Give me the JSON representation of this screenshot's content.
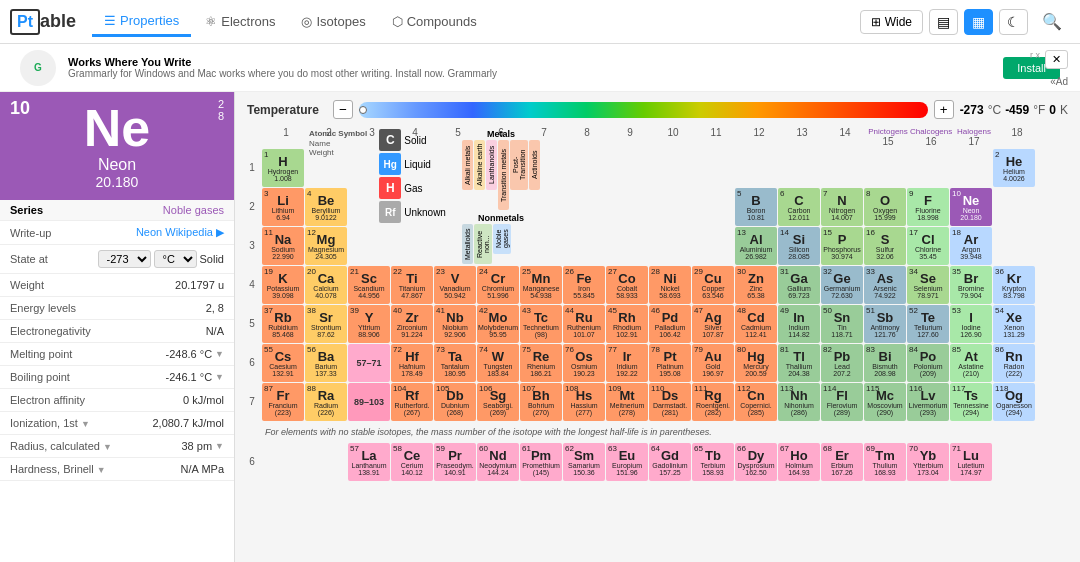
{
  "header": {
    "logo": "Pt",
    "logo_text": "able",
    "nav": [
      {
        "id": "properties",
        "label": "Properties",
        "icon": "☰",
        "active": true
      },
      {
        "id": "electrons",
        "label": "Electrons",
        "icon": "⚛",
        "active": false
      },
      {
        "id": "isotopes",
        "label": "Isotopes",
        "icon": "◎",
        "active": false
      },
      {
        "id": "compounds",
        "label": "Compounds",
        "icon": "⬡",
        "active": false
      }
    ],
    "wide_label": "Wide",
    "search_icon": "🔍"
  },
  "ad": {
    "logo": "G",
    "title": "Works Where You Write",
    "description": "Grammarly for Windows and Mac works where you do most other writing. Install now. Grammarly",
    "install_label": "Install",
    "close": "r x",
    "ad_label": "«Ad"
  },
  "left_panel": {
    "atomic_number": "10",
    "electrons": "2\n8",
    "symbol": "Ne",
    "name": "Neon",
    "weight": "20.180",
    "series_label": "Series",
    "series_value": "Noble gases",
    "writeup_label": "Write-up",
    "writeup_value": "Neon",
    "writeup_link": "Wikipedia",
    "state_label": "State at",
    "state_temp": "-273",
    "state_unit": "°C",
    "state_value": "Solid",
    "weight_label": "Weight",
    "weight_value": "20.1797 u",
    "energy_label": "Energy levels",
    "energy_value": "2, 8",
    "electronegativity_label": "Electronegativity",
    "electronegativity_value": "N/A",
    "melting_label": "Melting point",
    "melting_value": "-248.6 °C",
    "boiling_label": "Boiling point",
    "boiling_value": "-246.1 °C",
    "electron_affinity_label": "Electron affinity",
    "electron_affinity_value": "0 kJ/mol",
    "ionization_label": "Ionization, 1st",
    "ionization_value": "2,080.7 kJ/mol",
    "radius_label": "Radius, calculated",
    "radius_value": "38 pm",
    "hardness_label": "Hardness, Brinell",
    "hardness_value": "N/A MPa"
  },
  "temp_bar": {
    "label": "Temperature",
    "celsius": "-273",
    "fahrenheit": "-459",
    "kelvin": "0",
    "unit_c": "°C",
    "unit_f": "°F",
    "unit_k": "K"
  },
  "legend": {
    "atomic_symbol_label": "Atomic Symbol",
    "name_label": "Name",
    "weight_label": "Weight",
    "solid_label": "Solid",
    "liquid_label": "Liquid",
    "gas_label": "Gas",
    "unknown_label": "Unknown"
  },
  "group_labels": [
    "1",
    "2",
    "3",
    "4",
    "5",
    "6",
    "7",
    "8",
    "9",
    "10",
    "11",
    "12",
    "13",
    "14",
    "15",
    "16",
    "17",
    "18"
  ],
  "period_labels": [
    "1",
    "2",
    "3",
    "4",
    "5",
    "6",
    "7"
  ],
  "special_groups": {
    "pnictogens": "Pnictogens",
    "chalcogens": "Chalcogens",
    "halogens": "Halogens"
  },
  "footnote": "For elements with no stable isotopes, the mass number of the isotope with the longest half-life is in parentheses.",
  "elements": {
    "row1": [
      {
        "n": 1,
        "sym": "H",
        "name": "Hydrogen",
        "wt": "1.008",
        "cat": "reactive-nonmetal"
      },
      {
        "n": 2,
        "sym": "He",
        "name": "Helium",
        "wt": "4.0026",
        "cat": "noble"
      }
    ],
    "row2": [
      {
        "n": 3,
        "sym": "Li",
        "name": "Lithium",
        "wt": "6.94",
        "cat": "alkali"
      },
      {
        "n": 4,
        "sym": "Be",
        "name": "Beryllium",
        "wt": "9.0122",
        "cat": "alkaline"
      },
      {
        "n": 5,
        "sym": "B",
        "name": "Boron",
        "wt": "10.81",
        "cat": "metalloid"
      },
      {
        "n": 6,
        "sym": "C",
        "name": "Carbon",
        "wt": "12.011",
        "cat": "reactive-nonmetal"
      },
      {
        "n": 7,
        "sym": "N",
        "name": "Nitrogen",
        "wt": "14.007",
        "cat": "reactive-nonmetal"
      },
      {
        "n": 8,
        "sym": "O",
        "name": "Oxygen",
        "wt": "15.999",
        "cat": "reactive-nonmetal"
      },
      {
        "n": 9,
        "sym": "F",
        "name": "Fluorine",
        "wt": "18.998",
        "cat": "halogen"
      },
      {
        "n": 10,
        "sym": "Ne",
        "name": "Neon",
        "wt": "20.180",
        "cat": "noble"
      }
    ],
    "row3": [
      {
        "n": 11,
        "sym": "Na",
        "name": "Sodium",
        "wt": "22.990",
        "cat": "alkali"
      },
      {
        "n": 12,
        "sym": "Mg",
        "name": "Magnesium",
        "wt": "24.305",
        "cat": "alkaline"
      },
      {
        "n": 13,
        "sym": "Al",
        "name": "Aluminium",
        "wt": "26.982",
        "cat": "post-trans"
      },
      {
        "n": 14,
        "sym": "Si",
        "name": "Silicon",
        "wt": "28.085",
        "cat": "metalloid"
      },
      {
        "n": 15,
        "sym": "P",
        "name": "Phosphorus",
        "wt": "30.974",
        "cat": "reactive-nonmetal"
      },
      {
        "n": 16,
        "sym": "S",
        "name": "Sulfur",
        "wt": "32.06",
        "cat": "reactive-nonmetal"
      },
      {
        "n": 17,
        "sym": "Cl",
        "name": "Chlorine",
        "wt": "35.45",
        "cat": "halogen"
      },
      {
        "n": 18,
        "sym": "Ar",
        "name": "Argon",
        "wt": "39.948",
        "cat": "noble"
      }
    ],
    "row4": [
      {
        "n": 19,
        "sym": "K",
        "name": "Potassium",
        "wt": "39.098",
        "cat": "alkali"
      },
      {
        "n": 20,
        "sym": "Ca",
        "name": "Calcium",
        "wt": "40.078",
        "cat": "alkaline"
      },
      {
        "n": 21,
        "sym": "Sc",
        "name": "Scandium",
        "wt": "44.956",
        "cat": "transition-metal"
      },
      {
        "n": 22,
        "sym": "Ti",
        "name": "Titanium",
        "wt": "47.867",
        "cat": "transition-metal"
      },
      {
        "n": 23,
        "sym": "V",
        "name": "Vanadium",
        "wt": "50.942",
        "cat": "transition-metal"
      },
      {
        "n": 24,
        "sym": "Cr",
        "name": "Chromium",
        "wt": "51.996",
        "cat": "transition-metal"
      },
      {
        "n": 25,
        "sym": "Mn",
        "name": "Manganese",
        "wt": "54.938",
        "cat": "transition-metal"
      },
      {
        "n": 26,
        "sym": "Fe",
        "name": "Iron",
        "wt": "55.845",
        "cat": "transition-metal"
      },
      {
        "n": 27,
        "sym": "Co",
        "name": "Cobalt",
        "wt": "58.933",
        "cat": "transition-metal"
      },
      {
        "n": 28,
        "sym": "Ni",
        "name": "Nickel",
        "wt": "58.693",
        "cat": "transition-metal"
      },
      {
        "n": 29,
        "sym": "Cu",
        "name": "Copper",
        "wt": "63.546",
        "cat": "transition-metal"
      },
      {
        "n": 30,
        "sym": "Zn",
        "name": "Zinc",
        "wt": "65.38",
        "cat": "transition-metal"
      },
      {
        "n": 31,
        "sym": "Ga",
        "name": "Gallium",
        "wt": "69.723",
        "cat": "post-trans"
      },
      {
        "n": 32,
        "sym": "Ge",
        "name": "Germanium",
        "wt": "72.630",
        "cat": "metalloid"
      },
      {
        "n": 33,
        "sym": "As",
        "name": "Arsenic",
        "wt": "74.922",
        "cat": "metalloid"
      },
      {
        "n": 34,
        "sym": "Se",
        "name": "Selenium",
        "wt": "78.971",
        "cat": "reactive-nonmetal"
      },
      {
        "n": 35,
        "sym": "Br",
        "name": "Bromine",
        "wt": "79.904",
        "cat": "halogen"
      },
      {
        "n": 36,
        "sym": "Kr",
        "name": "Krypton",
        "wt": "83.798",
        "cat": "noble"
      }
    ],
    "row5": [
      {
        "n": 37,
        "sym": "Rb",
        "name": "Rubidium",
        "wt": "85.468",
        "cat": "alkali"
      },
      {
        "n": 38,
        "sym": "Sr",
        "name": "Strontium",
        "wt": "87.62",
        "cat": "alkaline"
      },
      {
        "n": 39,
        "sym": "Y",
        "name": "Yttrium",
        "wt": "88.906",
        "cat": "transition-metal"
      },
      {
        "n": 40,
        "sym": "Zr",
        "name": "Zirconium",
        "wt": "91.224",
        "cat": "transition-metal"
      },
      {
        "n": 41,
        "sym": "Nb",
        "name": "Niobium",
        "wt": "92.906",
        "cat": "transition-metal"
      },
      {
        "n": 42,
        "sym": "Mo",
        "name": "Molybdenum",
        "wt": "95.95",
        "cat": "transition-metal"
      },
      {
        "n": 43,
        "sym": "Tc",
        "name": "Technetium",
        "wt": "(98)",
        "cat": "transition-metal"
      },
      {
        "n": 44,
        "sym": "Ru",
        "name": "Ruthenium",
        "wt": "101.07",
        "cat": "transition-metal"
      },
      {
        "n": 45,
        "sym": "Rh",
        "name": "Rhodium",
        "wt": "102.91",
        "cat": "transition-metal"
      },
      {
        "n": 46,
        "sym": "Pd",
        "name": "Palladium",
        "wt": "106.42",
        "cat": "transition-metal"
      },
      {
        "n": 47,
        "sym": "Ag",
        "name": "Silver",
        "wt": "107.87",
        "cat": "transition-metal"
      },
      {
        "n": 48,
        "sym": "Cd",
        "name": "Cadmium",
        "wt": "112.41",
        "cat": "transition-metal"
      },
      {
        "n": 49,
        "sym": "In",
        "name": "Indium",
        "wt": "114.82",
        "cat": "post-trans"
      },
      {
        "n": 50,
        "sym": "Sn",
        "name": "Tin",
        "wt": "118.71",
        "cat": "post-trans"
      },
      {
        "n": 51,
        "sym": "Sb",
        "name": "Antimony",
        "wt": "121.76",
        "cat": "metalloid"
      },
      {
        "n": 52,
        "sym": "Te",
        "name": "Tellurium",
        "wt": "127.60",
        "cat": "metalloid"
      },
      {
        "n": 53,
        "sym": "I",
        "name": "Iodine",
        "wt": "126.90",
        "cat": "halogen"
      },
      {
        "n": 54,
        "sym": "Xe",
        "name": "Xenon",
        "wt": "131.29",
        "cat": "noble"
      }
    ],
    "row6": [
      {
        "n": 55,
        "sym": "Cs",
        "name": "Caesium",
        "wt": "132.91",
        "cat": "alkali"
      },
      {
        "n": 56,
        "sym": "Ba",
        "name": "Barium",
        "wt": "137.33",
        "cat": "alkaline"
      },
      {
        "n": 57,
        "sym": "La",
        "name": "57-71",
        "wt": "",
        "cat": "lanthanide-ref"
      },
      {
        "n": 72,
        "sym": "Hf",
        "name": "Hafnium",
        "wt": "178.49",
        "cat": "transition-metal"
      },
      {
        "n": 73,
        "sym": "Ta",
        "name": "Tantalum",
        "wt": "180.95",
        "cat": "transition-metal"
      },
      {
        "n": 74,
        "sym": "W",
        "name": "Tungsten",
        "wt": "183.84",
        "cat": "transition-metal"
      },
      {
        "n": 75,
        "sym": "Re",
        "name": "Rhenium",
        "wt": "186.21",
        "cat": "transition-metal"
      },
      {
        "n": 76,
        "sym": "Os",
        "name": "Osmium",
        "wt": "190.23",
        "cat": "transition-metal"
      },
      {
        "n": 77,
        "sym": "Ir",
        "name": "Iridium",
        "wt": "192.22",
        "cat": "transition-metal"
      },
      {
        "n": 78,
        "sym": "Pt",
        "name": "Platinum",
        "wt": "195.08",
        "cat": "transition-metal"
      },
      {
        "n": 79,
        "sym": "Au",
        "name": "Gold",
        "wt": "196.97",
        "cat": "transition-metal"
      },
      {
        "n": 80,
        "sym": "Hg",
        "name": "Mercury",
        "wt": "200.59",
        "cat": "transition-metal"
      },
      {
        "n": 81,
        "sym": "Tl",
        "name": "Thallium",
        "wt": "204.38",
        "cat": "post-trans"
      },
      {
        "n": 82,
        "sym": "Pb",
        "name": "Lead",
        "wt": "207.2",
        "cat": "post-trans"
      },
      {
        "n": 83,
        "sym": "Bi",
        "name": "Bismuth",
        "wt": "208.98",
        "cat": "post-trans"
      },
      {
        "n": 84,
        "sym": "Po",
        "name": "Polonium",
        "wt": "(209)",
        "cat": "post-trans"
      },
      {
        "n": 85,
        "sym": "At",
        "name": "Astatine",
        "wt": "(210)",
        "cat": "halogen"
      },
      {
        "n": 86,
        "sym": "Rn",
        "name": "Radon",
        "wt": "(222)",
        "cat": "noble"
      }
    ],
    "row7": [
      {
        "n": 87,
        "sym": "Fr",
        "name": "Francium",
        "wt": "(223)",
        "cat": "alkali"
      },
      {
        "n": 88,
        "sym": "Ra",
        "name": "Radium",
        "wt": "(226)",
        "cat": "alkaline"
      },
      {
        "n": 89,
        "sym": "Ac",
        "name": "89-103",
        "wt": "",
        "cat": "actinide-ref"
      },
      {
        "n": 104,
        "sym": "Rf",
        "name": "Rutherford.",
        "wt": "(267)",
        "cat": "transition-metal"
      },
      {
        "n": 105,
        "sym": "Db",
        "name": "Dubnium",
        "wt": "(268)",
        "cat": "transition-metal"
      },
      {
        "n": 106,
        "sym": "Sg",
        "name": "Seaborgi.",
        "wt": "(269)",
        "cat": "transition-metal"
      },
      {
        "n": 107,
        "sym": "Bh",
        "name": "Bohrium",
        "wt": "(270)",
        "cat": "transition-metal"
      },
      {
        "n": 108,
        "sym": "Hs",
        "name": "Hassium",
        "wt": "(277)",
        "cat": "transition-metal"
      },
      {
        "n": 109,
        "sym": "Mt",
        "name": "Meitnerium",
        "wt": "(278)",
        "cat": "transition-metal"
      },
      {
        "n": 110,
        "sym": "Ds",
        "name": "Darmstadt.",
        "wt": "(281)",
        "cat": "transition-metal"
      },
      {
        "n": 111,
        "sym": "Rg",
        "name": "Roentgeni.",
        "wt": "(282)",
        "cat": "transition-metal"
      },
      {
        "n": 112,
        "sym": "Cn",
        "name": "Copernici.",
        "wt": "(285)",
        "cat": "transition-metal"
      },
      {
        "n": 113,
        "sym": "Nh",
        "name": "Nihonium",
        "wt": "(286)",
        "cat": "post-trans"
      },
      {
        "n": 114,
        "sym": "Fl",
        "name": "Flerovium",
        "wt": "(289)",
        "cat": "post-trans"
      },
      {
        "n": 115,
        "sym": "Mc",
        "name": "Moscovium",
        "wt": "(290)",
        "cat": "post-trans"
      },
      {
        "n": 116,
        "sym": "Lv",
        "name": "Livermorium",
        "wt": "(293)",
        "cat": "post-trans"
      },
      {
        "n": 117,
        "sym": "Ts",
        "name": "Tennessine",
        "wt": "(294)",
        "cat": "halogen"
      },
      {
        "n": 118,
        "sym": "Og",
        "name": "Oganesson",
        "wt": "(294)",
        "cat": "noble"
      }
    ],
    "lanthanides": [
      {
        "n": 57,
        "sym": "La",
        "name": "Lanthanum",
        "wt": "138.91",
        "cat": "lanthanide"
      },
      {
        "n": 58,
        "sym": "Ce",
        "name": "Cerium",
        "wt": "140.12",
        "cat": "lanthanide"
      },
      {
        "n": 59,
        "sym": "Pr",
        "name": "Praseodym.",
        "wt": "140.91",
        "cat": "lanthanide"
      },
      {
        "n": 60,
        "sym": "Nd",
        "name": "Neodymium",
        "wt": "144.24",
        "cat": "lanthanide"
      },
      {
        "n": 61,
        "sym": "Pm",
        "name": "Promethium",
        "wt": "(145)",
        "cat": "lanthanide"
      },
      {
        "n": 62,
        "sym": "Sm",
        "name": "Samarium",
        "wt": "150.36",
        "cat": "lanthanide"
      },
      {
        "n": 63,
        "sym": "Eu",
        "name": "Europium",
        "wt": "151.96",
        "cat": "lanthanide"
      },
      {
        "n": 64,
        "sym": "Gd",
        "name": "Gadolinium",
        "wt": "157.25",
        "cat": "lanthanide"
      },
      {
        "n": 65,
        "sym": "Tb",
        "name": "Terbium",
        "wt": "158.93",
        "cat": "lanthanide"
      },
      {
        "n": 66,
        "sym": "Dy",
        "name": "Dysprosium",
        "wt": "162.50",
        "cat": "lanthanide"
      },
      {
        "n": 67,
        "sym": "Ho",
        "name": "Holmium",
        "wt": "164.93",
        "cat": "lanthanide"
      },
      {
        "n": 68,
        "sym": "Er",
        "name": "Erbium",
        "wt": "167.26",
        "cat": "lanthanide"
      },
      {
        "n": 69,
        "sym": "Tm",
        "name": "Thulium",
        "wt": "168.93",
        "cat": "lanthanide"
      },
      {
        "n": 70,
        "sym": "Yb",
        "name": "Ytterbium",
        "wt": "173.04",
        "cat": "lanthanide"
      },
      {
        "n": 71,
        "sym": "Lu",
        "name": "Lutetium",
        "wt": "174.97",
        "cat": "lanthanide"
      }
    ]
  },
  "colors": {
    "alkali": "#ff9966",
    "alkaline": "#ffcc66",
    "transition-metal": "#ff9966",
    "post-trans": "#99cc99",
    "metalloid": "#99bbcc",
    "reactive-nonmetal": "#a8d890",
    "halogen": "#a8e8a8",
    "noble": "#b8d8ff",
    "lanthanide": "#ffaacc",
    "actinide": "#ff99bb",
    "lanthanide-ref": "#ffaacc",
    "actinide-ref": "#ff99bb",
    "unknown": "#cccccc",
    "selected": "#9b59b6"
  }
}
